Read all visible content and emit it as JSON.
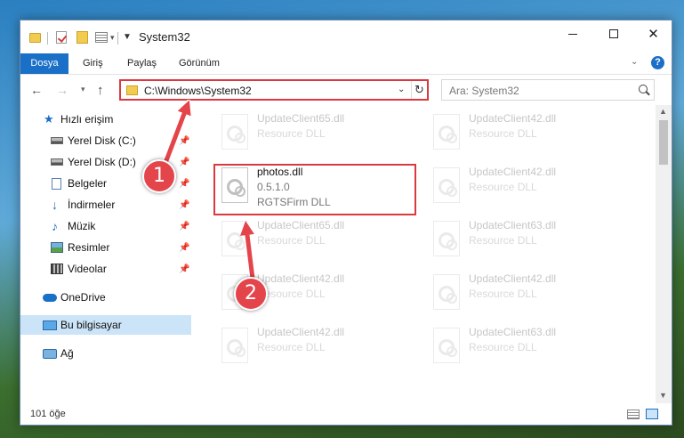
{
  "window": {
    "title": "System32",
    "min_label": "",
    "max_label": "",
    "close_label": "✕"
  },
  "ribbon": {
    "tabs": [
      "Dosya",
      "Giriş",
      "Paylaş",
      "Görünüm"
    ],
    "help": "?"
  },
  "nav": {
    "address": "C:\\Windows\\System32",
    "search_placeholder": "Ara: System32"
  },
  "sidebar": {
    "items": [
      {
        "label": "Hızlı erişim",
        "icon": "star-icon"
      },
      {
        "label": "Yerel Disk (C:)",
        "icon": "drive-icon",
        "pinned": true
      },
      {
        "label": "Yerel Disk (D:)",
        "icon": "drive-icon",
        "pinned": true
      },
      {
        "label": "Belgeler",
        "icon": "documents-icon",
        "pinned": true
      },
      {
        "label": "İndirmeler",
        "icon": "download-icon",
        "pinned": true
      },
      {
        "label": "Müzik",
        "icon": "music-icon",
        "pinned": true
      },
      {
        "label": "Resimler",
        "icon": "pictures-icon",
        "pinned": true
      },
      {
        "label": "Videolar",
        "icon": "videos-icon",
        "pinned": true
      },
      {
        "label": "OneDrive",
        "icon": "cloud-icon"
      },
      {
        "label": "Bu bilgisayar",
        "icon": "computer-icon",
        "selected": true
      },
      {
        "label": "Ağ",
        "icon": "network-icon"
      }
    ]
  },
  "files": {
    "highlighted": {
      "name": "photos.dll",
      "version": "0.5.1.0",
      "description": "RGTSFirm DLL"
    },
    "faded": [
      {
        "name": "UpdateClient65.dll",
        "type": "Resource DLL"
      },
      {
        "name": "UpdateClient42.dll",
        "type": "Resource DLL"
      },
      {
        "name": "UpdateClient42.dll",
        "type": "Resource DLL"
      },
      {
        "name": "UpdateClient65.dll",
        "type": "Resource DLL"
      },
      {
        "name": "UpdateClient63.dll",
        "type": "Resource DLL"
      },
      {
        "name": "UpdateClient42.dll",
        "type": "Resource DLL"
      },
      {
        "name": "UpdateClient42.dll",
        "type": "Resource DLL"
      },
      {
        "name": "UpdateClient42.dll",
        "type": "Resource DLL"
      },
      {
        "name": "UpdateClient63.dll",
        "type": "Resource DLL"
      }
    ]
  },
  "status": {
    "item_count": "101 öğe"
  },
  "annotations": {
    "step1": "1",
    "step2": "2",
    "color": "#e3454b"
  },
  "colors": {
    "accent": "#1a6fc7",
    "highlight_border": "#d9393f",
    "selection": "#cce4f7"
  }
}
